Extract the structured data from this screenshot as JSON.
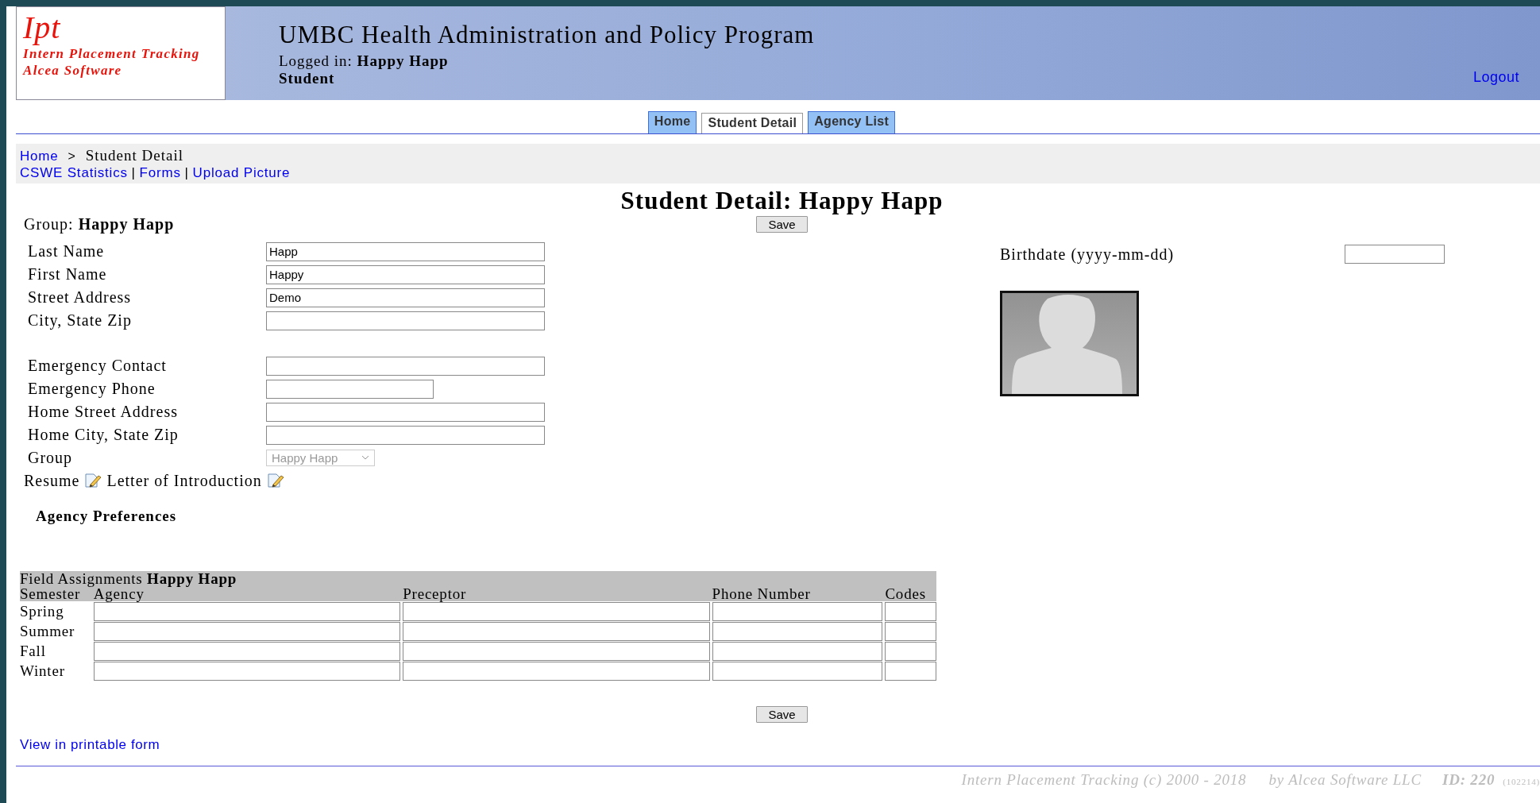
{
  "header": {
    "logo_mark": "Ipt",
    "logo_line_1": "Intern Placement Tracking",
    "logo_line_2": "Alcea Software",
    "title": "UMBC Health Administration and Policy Program",
    "logged_in_label": "Logged in:",
    "logged_in_user": "Happy Happ",
    "role": "Student",
    "logout": "Logout"
  },
  "tabs": [
    {
      "label": "Home",
      "selected": false
    },
    {
      "label": "Student Detail",
      "selected": true
    },
    {
      "label": "Agency List",
      "selected": false
    }
  ],
  "breadcrumb": [
    {
      "label": "Home",
      "kind": "link"
    },
    {
      "label": ">",
      "kind": "separator"
    },
    {
      "label": "Student Detail",
      "kind": "current"
    }
  ],
  "links": [
    {
      "label": "CSWE Statistics",
      "kind": "link"
    },
    {
      "label": "|",
      "kind": "separator"
    },
    {
      "label": "Forms",
      "kind": "link"
    },
    {
      "label": "|",
      "kind": "separator"
    },
    {
      "label": "Upload Picture",
      "kind": "link"
    }
  ],
  "page_title": "Student Detail: Happy Happ",
  "group": {
    "label": "Group:",
    "value": "Happy Happ"
  },
  "save_top": "Save",
  "personal_fields": [
    {
      "label": "Last Name",
      "kind": "text",
      "value": "Happ"
    },
    {
      "label": "First Name",
      "kind": "text",
      "value": "Happy"
    },
    {
      "label": "Street Address",
      "kind": "text",
      "value": "Demo"
    },
    {
      "label": "City, State Zip",
      "kind": "text"
    }
  ],
  "contact_fields": [
    {
      "label": "Emergency Contact",
      "kind": "text"
    },
    {
      "label": "Emergency Phone",
      "kind": "short"
    },
    {
      "label": "Home Street Address",
      "kind": "text"
    },
    {
      "label": "Home City, State Zip",
      "kind": "text"
    },
    {
      "label": "Group",
      "kind": "select",
      "value": "Happy Happ",
      "disabled": true
    }
  ],
  "documents": [
    {
      "label": "Resume"
    },
    {
      "label": "Letter of Introduction"
    }
  ],
  "agency_preferences_heading": "Agency Preferences",
  "birthdate": {
    "label": "Birthdate (yyyy-mm-dd)"
  },
  "field_assignments": {
    "title": "Field Assignments",
    "title_name": "Happy Happ",
    "columns": [
      "Semester",
      "Agency",
      "Preceptor",
      "Phone Number",
      "Codes"
    ],
    "rows": [
      {
        "semester": "Spring"
      },
      {
        "semester": "Summer"
      },
      {
        "semester": "Fall"
      },
      {
        "semester": "Winter"
      }
    ]
  },
  "save_bottom": "Save",
  "print_link": "View in printable form",
  "footer": {
    "copyright": "Intern Placement Tracking (c) 2000 - 2018",
    "company": "by Alcea Software LLC",
    "id": "ID: 220",
    "build": "(102214)"
  }
}
